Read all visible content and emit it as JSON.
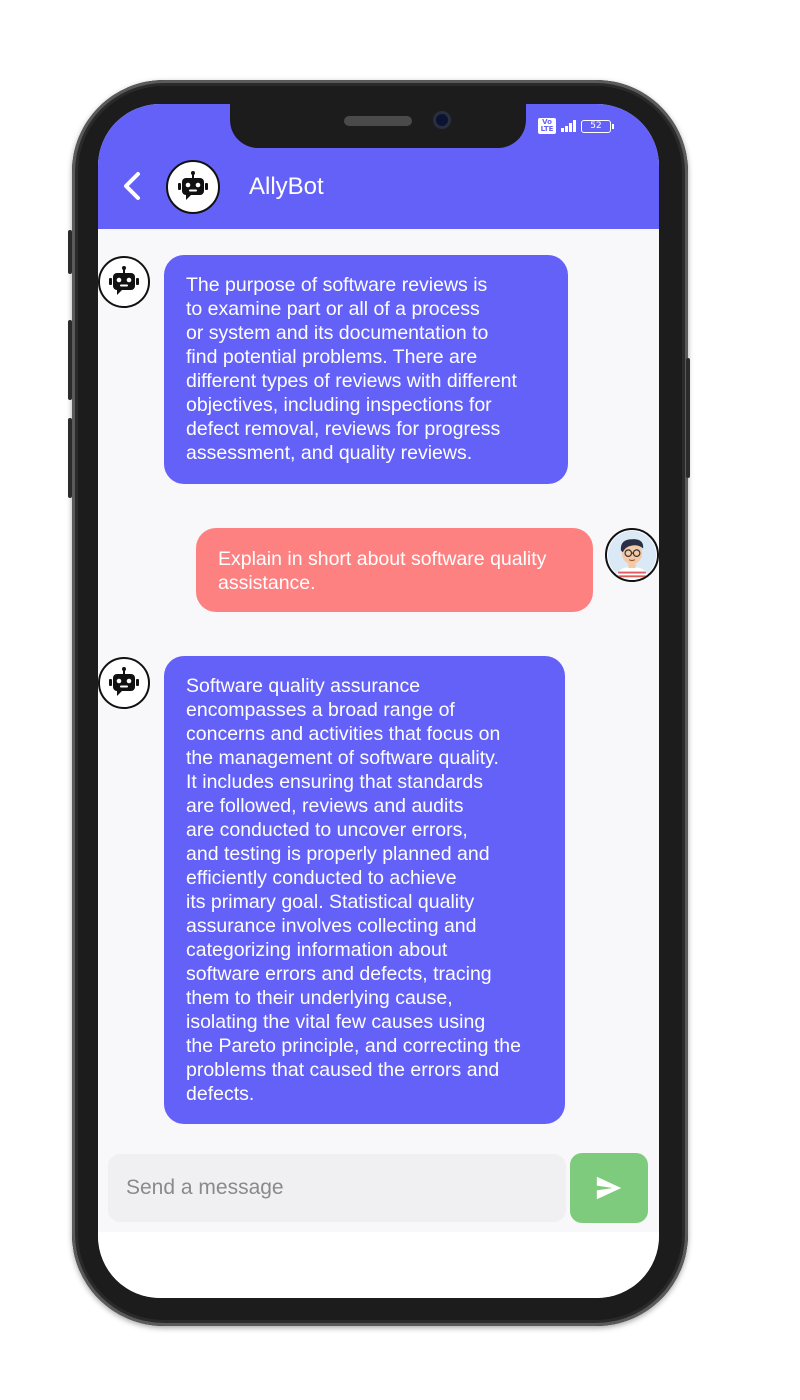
{
  "header": {
    "title": "AllyBot",
    "back_icon": "chevron-left-icon",
    "avatar_icon": "robot-icon",
    "color": "#6461f9"
  },
  "status_bar": {
    "network": "Vo LTE",
    "battery": "52"
  },
  "messages": [
    {
      "sender": "bot",
      "icon": "robot-icon",
      "lines": [
        "The purpose of software reviews is",
        "to examine part or all of a process",
        "or system and its documentation to",
        "find potential problems. There are",
        "different types of reviews with different",
        "objectives, including inspections for",
        "defect removal, reviews for progress",
        "assessment, and quality reviews."
      ]
    },
    {
      "sender": "user",
      "icon": "user-avatar-icon",
      "lines": [
        "Explain in short about software quality",
        "assistance."
      ]
    },
    {
      "sender": "bot",
      "icon": "robot-icon",
      "lines": [
        "Software quality assurance",
        "encompasses a broad range of",
        "concerns and activities that focus on",
        "the management of software quality.",
        "It includes ensuring that standards",
        "are followed, reviews and audits",
        "are conducted to uncover errors,",
        "and testing is properly planned and",
        "efficiently conducted to achieve",
        "its primary goal. Statistical quality",
        "assurance involves collecting and",
        "categorizing information about",
        "software errors and defects, tracing",
        "them to their underlying cause,",
        "isolating the vital few causes using",
        "the Pareto principle, and correcting the",
        "problems that caused the errors and",
        "defects."
      ]
    }
  ],
  "composer": {
    "placeholder": "Send a message",
    "send_icon": "send-icon",
    "send_color": "#7ecb7e"
  },
  "colors": {
    "bot_bubble": "#6461f9",
    "user_bubble": "#fe8181",
    "background": "#f8f8fb"
  }
}
